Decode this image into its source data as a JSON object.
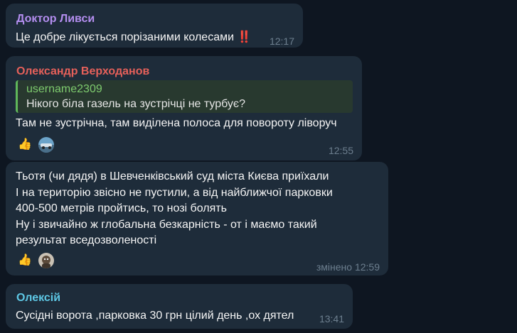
{
  "messages": [
    {
      "sender": "Доктор Ливси",
      "sender_color": "#b48ef0",
      "text": "Це добре лікується порізаними колесами ‼️",
      "time": "12:17"
    },
    {
      "sender": "Олександр Верходанов",
      "sender_color": "#e5605a",
      "reply": {
        "name": "username2309",
        "text": "Нікого біла газель на зустрічці не турбує?"
      },
      "text": "Там не зустрічна, там виділена полоса для повороту ліворуч",
      "reactions": [
        {
          "emoji": "👍",
          "icon": "thumbs-up-icon"
        },
        {
          "icon": "reactor-avatar"
        }
      ],
      "time": "12:55"
    },
    {
      "lines": [
        "Тьотя (чи дядя) в Шевченківський суд міста Києва приїхали",
        "І на територію звісно не пустили, а від найближчої парковки",
        "400-500 метрів пройтись, то нозі болять",
        "Ну і звичайно ж глобальна безкарність - от і маємо такий",
        "результат вседозволеності"
      ],
      "reactions": [
        {
          "emoji": "👍",
          "icon": "thumbs-up-icon"
        },
        {
          "icon": "reactor-avatar"
        }
      ],
      "time": "змінено 12:59"
    },
    {
      "sender": "Олексій",
      "sender_color": "#5ec8e5",
      "text": "Сусідні ворота ,парковка 30 грн цілий день ,ох дятел",
      "time": "13:41"
    }
  ]
}
